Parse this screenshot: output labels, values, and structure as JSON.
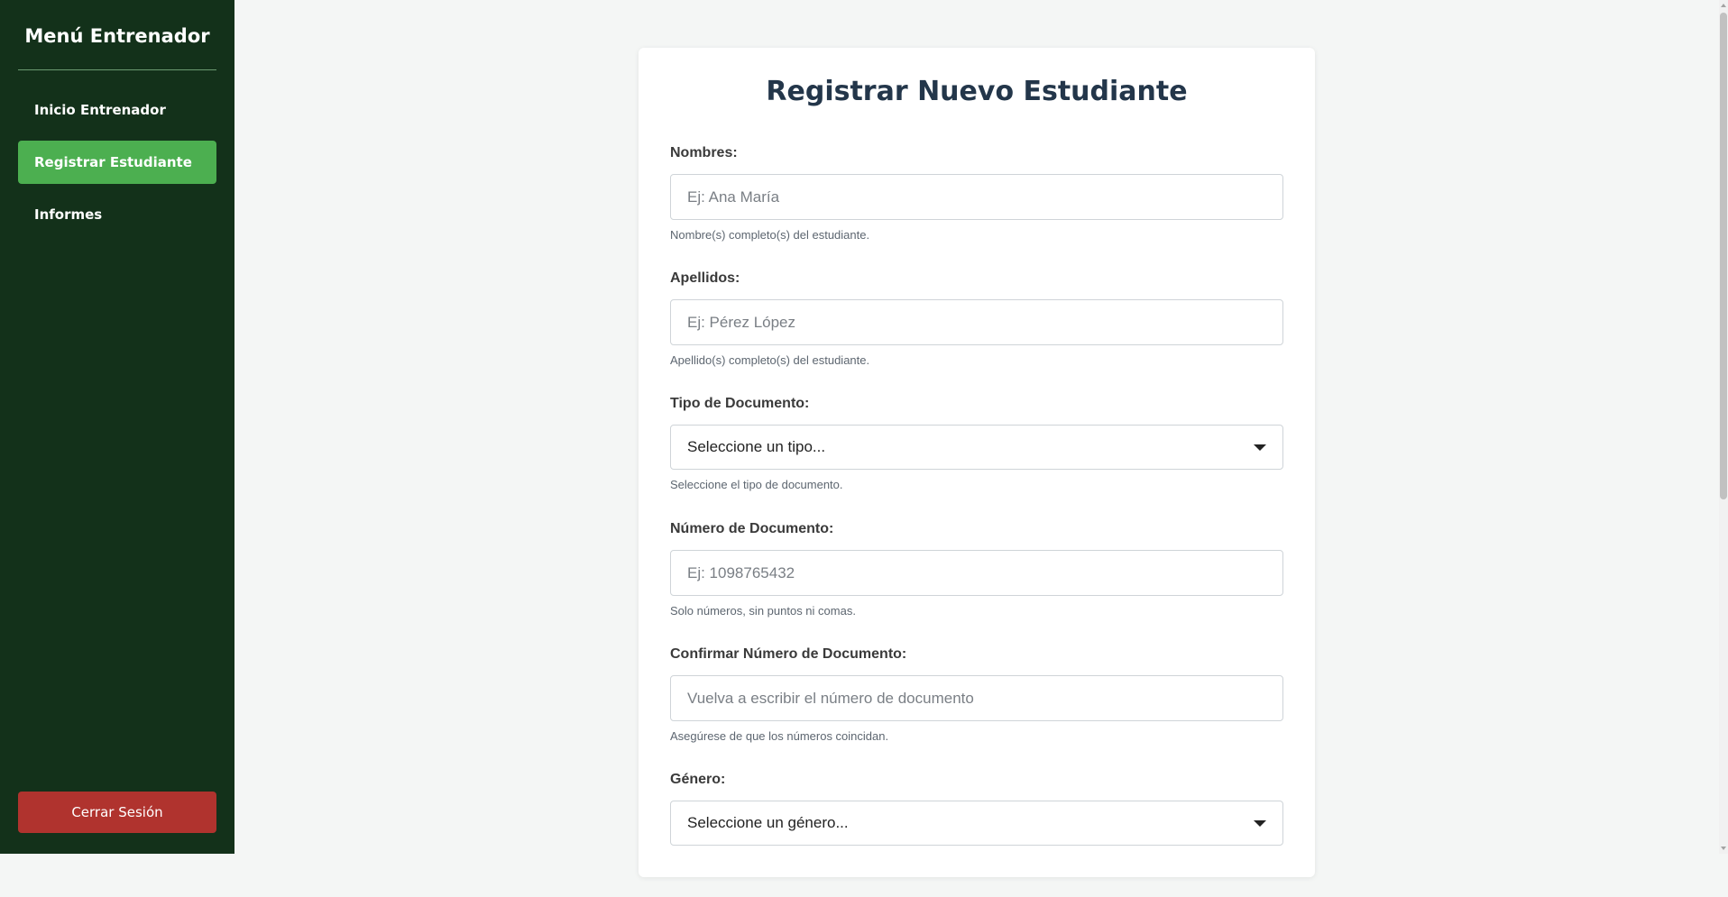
{
  "sidebar": {
    "title": "Menú Entrenador",
    "items": [
      {
        "label": "Inicio Entrenador"
      },
      {
        "label": "Registrar Estudiante"
      },
      {
        "label": "Informes"
      }
    ],
    "logout_label": "Cerrar Sesión"
  },
  "form": {
    "title": "Registrar Nuevo Estudiante",
    "nombres": {
      "label": "Nombres:",
      "placeholder": "Ej: Ana María",
      "help": "Nombre(s) completo(s) del estudiante."
    },
    "apellidos": {
      "label": "Apellidos:",
      "placeholder": "Ej: Pérez López",
      "help": "Apellido(s) completo(s) del estudiante."
    },
    "tipo_documento": {
      "label": "Tipo de Documento:",
      "selected": "Seleccione un tipo...",
      "help": "Seleccione el tipo de documento."
    },
    "numero_documento": {
      "label": "Número de Documento:",
      "placeholder": "Ej: 1098765432",
      "help": "Solo números, sin puntos ni comas."
    },
    "confirmar_documento": {
      "label": "Confirmar Número de Documento:",
      "placeholder": "Vuelva a escribir el número de documento",
      "help": "Asegúrese de que los números coincidan."
    },
    "genero": {
      "label": "Género:",
      "selected": "Seleccione un género..."
    }
  },
  "colors": {
    "sidebar_bg": "#13311a",
    "active_item": "#4caf50",
    "logout_button": "#b0332e",
    "title_text": "#23364a"
  }
}
